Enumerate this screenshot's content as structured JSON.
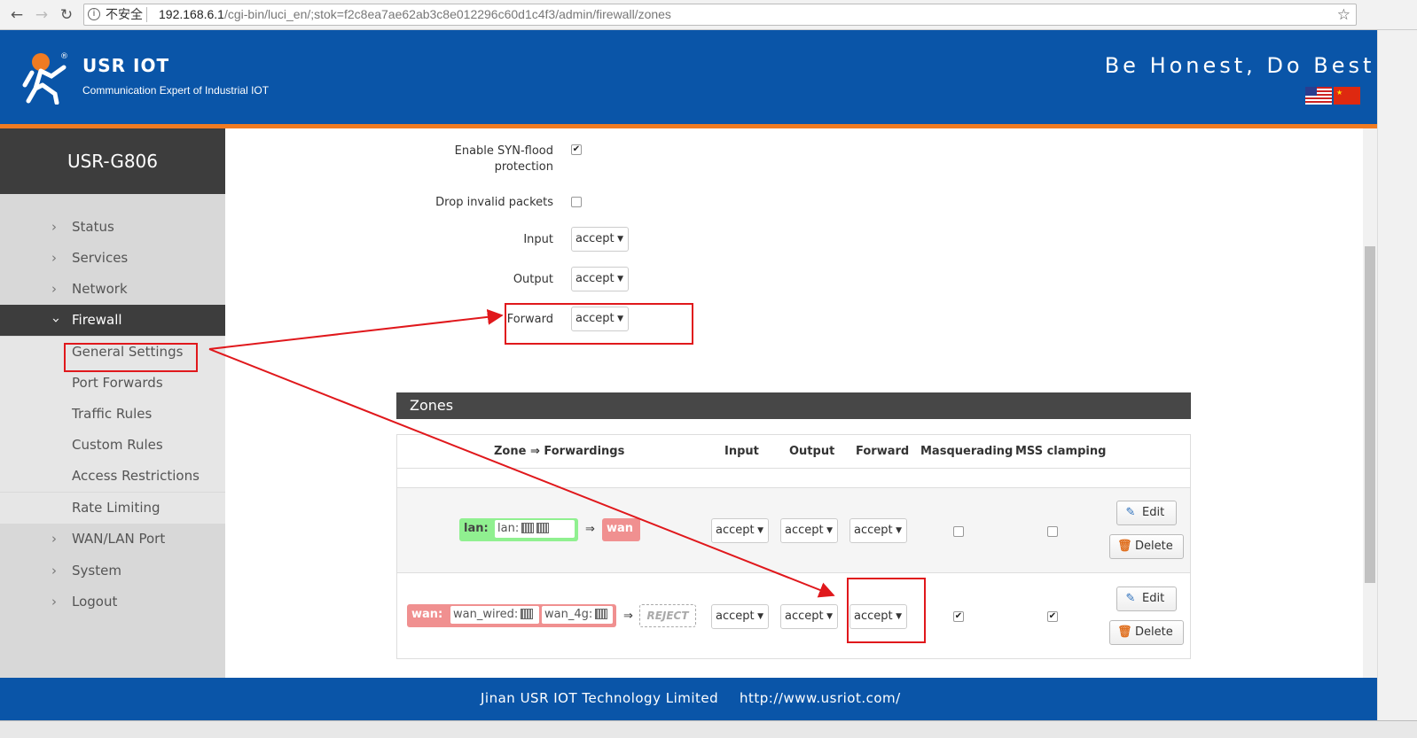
{
  "browser": {
    "security_label": "不安全",
    "url_host": "192.168.6.1",
    "url_path": "/cgi-bin/luci_en/;stok=f2c8ea7ae62ab3c8e012296c60d1c4f3/admin/firewall/zones"
  },
  "header": {
    "brand": "USR IOT",
    "tagline": "Communication Expert of Industrial IOT",
    "slogan": "Be Honest, Do Best!"
  },
  "sidebar": {
    "device": "USR-G806",
    "items": [
      {
        "label": "Status"
      },
      {
        "label": "Services"
      },
      {
        "label": "Network"
      },
      {
        "label": "Firewall"
      },
      {
        "label": "WAN/LAN Port"
      },
      {
        "label": "System"
      },
      {
        "label": "Logout"
      }
    ],
    "firewall_sub": [
      {
        "label": "General Settings"
      },
      {
        "label": "Port Forwards"
      },
      {
        "label": "Traffic Rules"
      },
      {
        "label": "Custom Rules"
      },
      {
        "label": "Access Restrictions"
      },
      {
        "label": "Rate Limiting"
      }
    ]
  },
  "general": {
    "syn_label_1": "Enable SYN-flood",
    "syn_label_2": "protection",
    "syn_checked": true,
    "drop_label": "Drop invalid packets",
    "drop_checked": false,
    "input_label": "Input",
    "input_value": "accept",
    "output_label": "Output",
    "output_value": "accept",
    "forward_label": "Forward",
    "forward_value": "accept"
  },
  "zones": {
    "title": "Zones",
    "columns": {
      "zone": "Zone ⇒ Forwardings",
      "input": "Input",
      "output": "Output",
      "forward": "Forward",
      "masq": "Masquerading",
      "mss": "MSS clamping"
    },
    "rows": [
      {
        "zone": "lan:",
        "net": "lan:",
        "arrow": "⇒",
        "dest": "wan",
        "input": "accept",
        "output": "accept",
        "forward": "accept",
        "masq": false,
        "mss": false,
        "edit": "Edit",
        "delete": "Delete"
      },
      {
        "zone": "wan:",
        "net1": "wan_wired:",
        "net2": "wan_4g:",
        "arrow": "⇒",
        "dest": "REJECT",
        "input": "accept",
        "output": "accept",
        "forward": "accept",
        "masq": true,
        "mss": true,
        "edit": "Edit",
        "delete": "Delete"
      }
    ]
  },
  "footer": {
    "company": "Jinan USR IOT Technology Limited",
    "website": "http://www.usriot.com/"
  },
  "colors": {
    "header_blue": "#0a55a8",
    "accent_orange": "#f07b22",
    "annotation_red": "#e0181c",
    "lan_green": "#90f090",
    "wan_red": "#f09090"
  }
}
